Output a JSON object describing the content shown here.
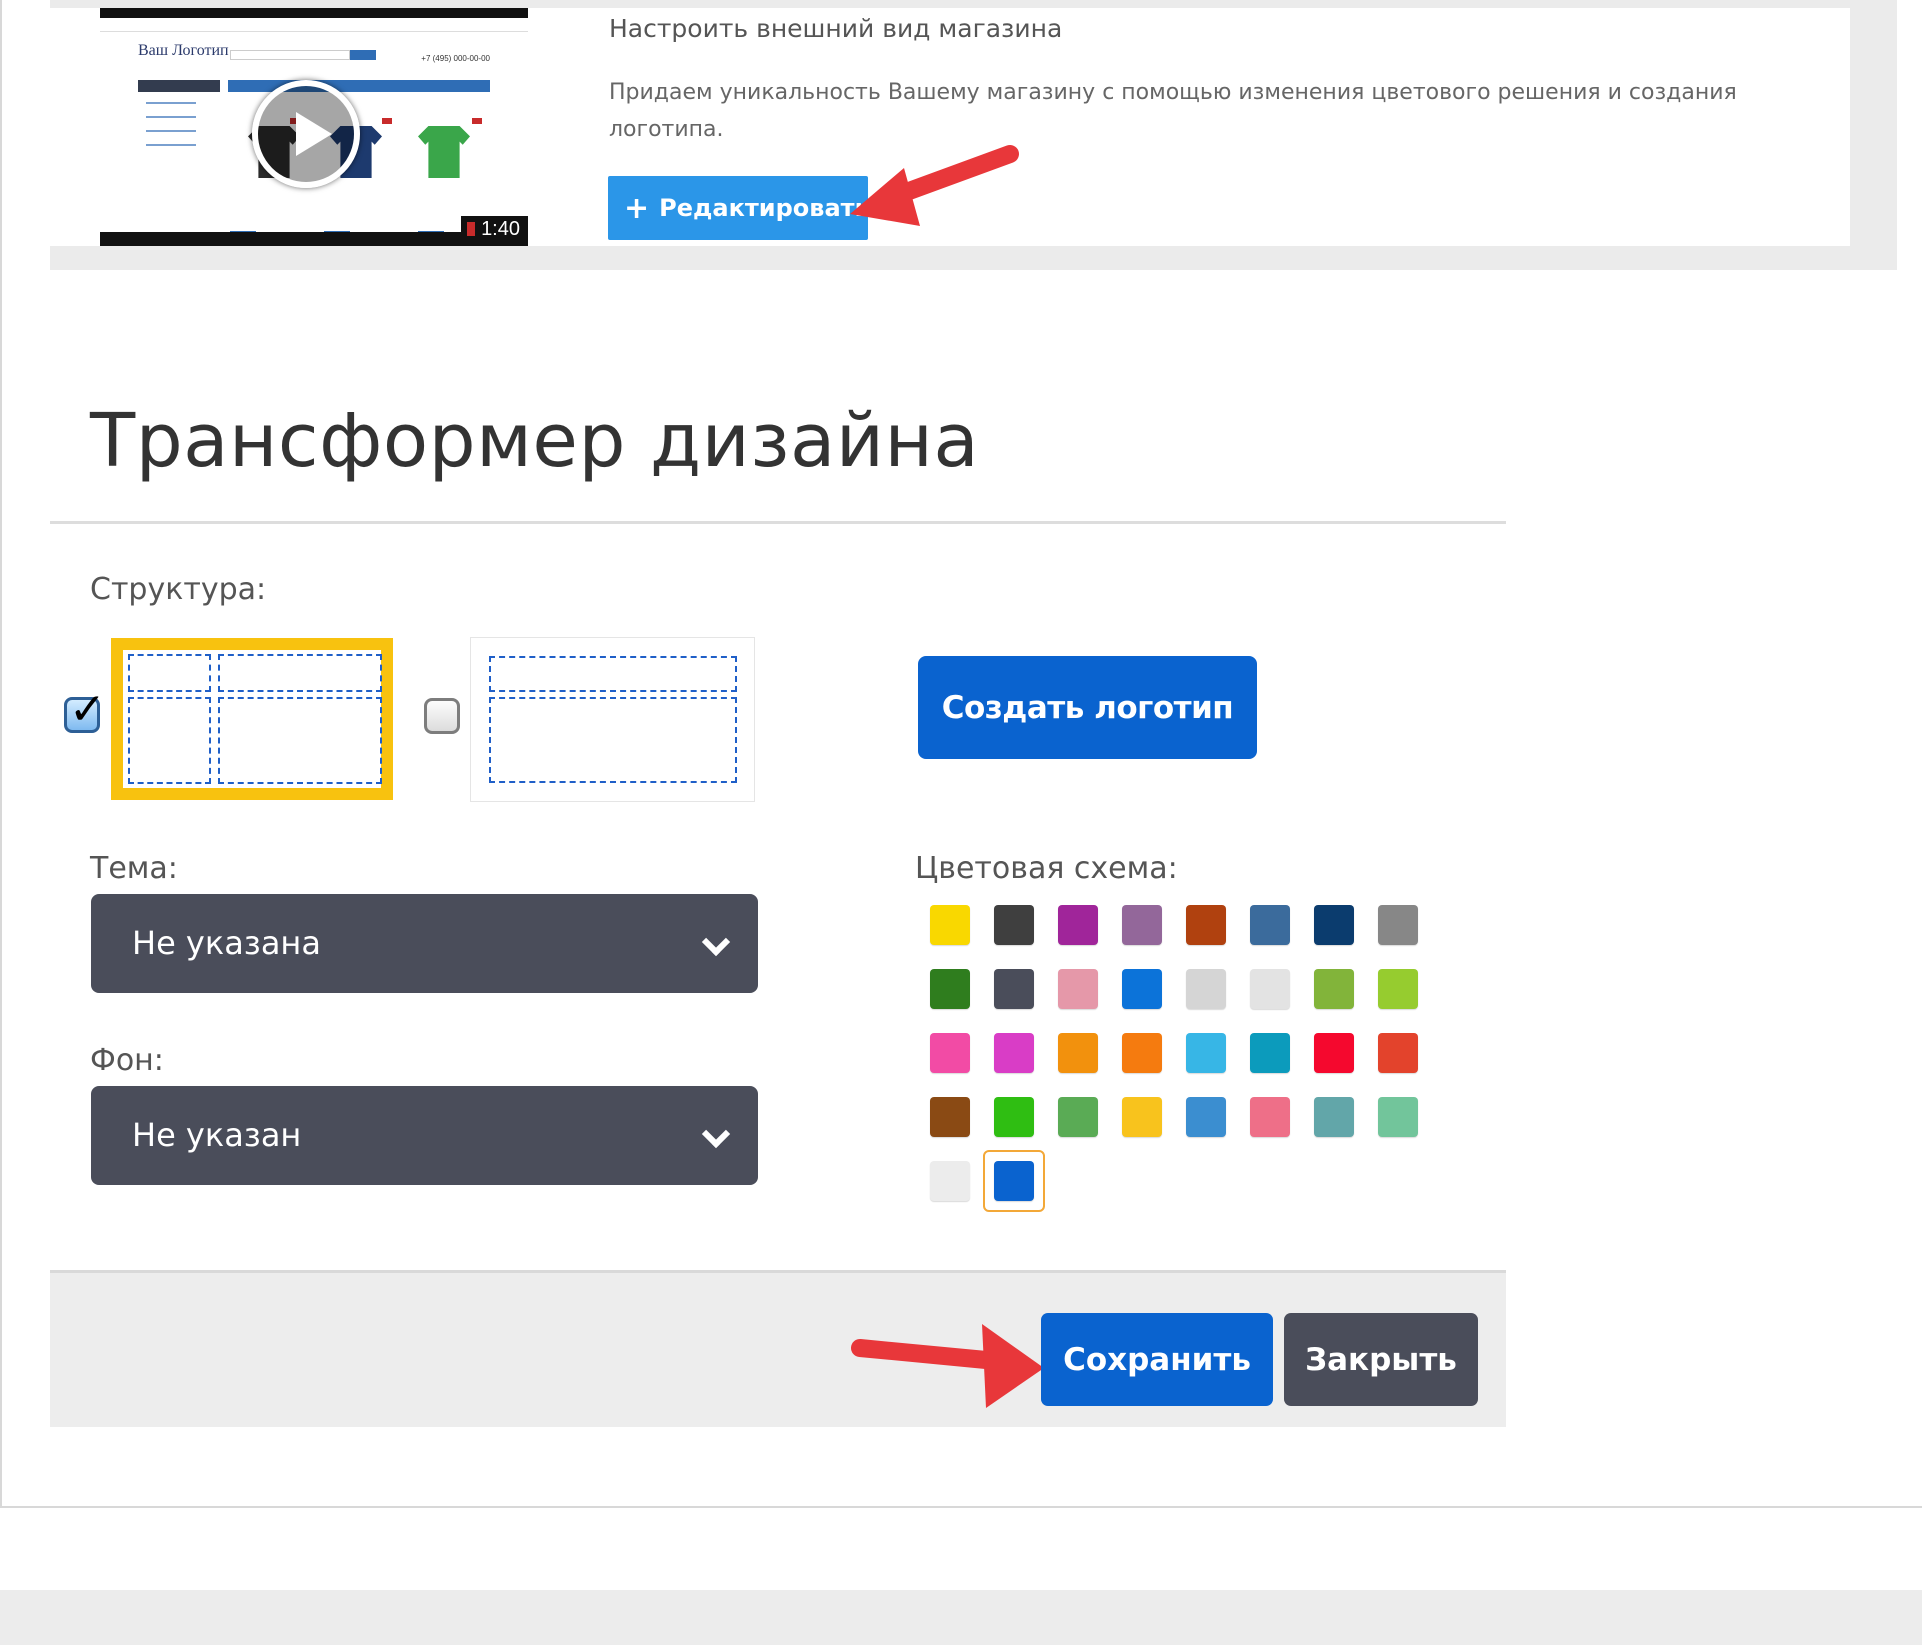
{
  "customize_card": {
    "title": "Настроить внешний вид магазина",
    "description": "Придаем уникальность Вашему магазину с помощью изменения цветового решения и создания логотипа.",
    "edit_button": "Редактировать",
    "edit_icon": "plus-icon",
    "video": {
      "logo_text": "Ваш Логотип",
      "phone_text": "+7 (495) 000-00-00",
      "duration": "1:40",
      "play_icon": "play-icon"
    }
  },
  "transformer": {
    "title": "Трансформер дизайна",
    "structure_label": "Структура:",
    "structures": [
      {
        "name": "sidebar-layout",
        "checked": true
      },
      {
        "name": "full-width-layout",
        "checked": false
      }
    ],
    "create_logo_button": "Создать логотип",
    "theme_label": "Тема:",
    "theme_value": "Не указана",
    "background_label": "Фон:",
    "background_value": "Не указан",
    "color_scheme_label": "Цветовая схема:",
    "color_swatches": [
      "#f9d800",
      "#3f3f3f",
      "#a0259a",
      "#93679a",
      "#b0410f",
      "#3b6b9c",
      "#0b3c6e",
      "#878787",
      "#2f7d1e",
      "#4a4d5a",
      "#e598a9",
      "#0c73d9",
      "#d5d5d5",
      "#e3e3e3",
      "#82b43a",
      "#96cc2f",
      "#f24ba5",
      "#d93dc6",
      "#f2910d",
      "#f57b0f",
      "#37b6e6",
      "#0c9bbc",
      "#f5082e",
      "#e3432c",
      "#8a4a14",
      "#2fbe12",
      "#5aab55",
      "#f8c31d",
      "#3b8ed0",
      "#ee6f88",
      "#62a6a9",
      "#72c59b",
      "#ececec",
      "#0a63cf"
    ],
    "selected_swatch_index": 33,
    "save_button": "Сохранить",
    "close_button": "Закрыть"
  },
  "colors": {
    "primary_blue": "#0a63cf",
    "light_blue": "#2b96e8",
    "dark_gray": "#4a4d5a",
    "yellow_highlight": "#f8c20f",
    "arrow_red": "#e8373a"
  }
}
